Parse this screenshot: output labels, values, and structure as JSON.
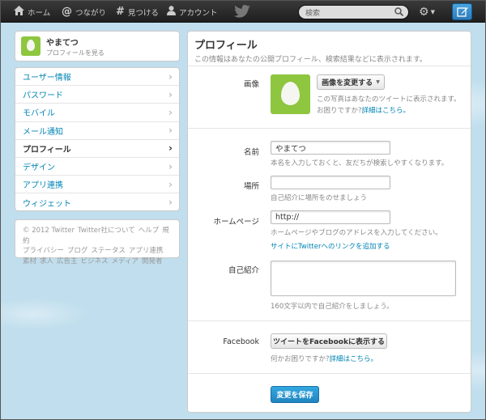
{
  "topbar": {
    "home_label": "ホーム",
    "connect_label": "つながり",
    "discover_label": "見つける",
    "account_label": "アカウント",
    "search_placeholder": "検索"
  },
  "profile_card": {
    "name": "やまてつ",
    "sub": "プロフィールを見る"
  },
  "sidenav": {
    "items": [
      {
        "label": "ユーザー情報"
      },
      {
        "label": "パスワード"
      },
      {
        "label": "モバイル"
      },
      {
        "label": "メール通知"
      },
      {
        "label": "プロフィール"
      },
      {
        "label": "デザイン"
      },
      {
        "label": "アプリ連携"
      },
      {
        "label": "ウィジェット"
      }
    ]
  },
  "footer": {
    "line1": [
      "© 2012 Twitter",
      "Twitter社について",
      "ヘルプ",
      "規約"
    ],
    "line2": [
      "プライバシー",
      "ブログ",
      "ステータス",
      "アプリ連携"
    ],
    "line3": [
      "素材",
      "求人",
      "広告主",
      "ビジネス",
      "メディア",
      "開発者"
    ]
  },
  "main": {
    "title": "プロフィール",
    "subtitle": "この情報はあなたの公開プロフィール、検索結果などに表示されます。",
    "image": {
      "label": "画像",
      "button": "画像を変更する",
      "hint": "この写真はあなたのツイートに表示されます。",
      "help_prefix": "お困りですか?",
      "help_link": "詳細はこちら。"
    },
    "name": {
      "label": "名前",
      "value": "やまてつ",
      "hint": "本名を入力しておくと、友だちが検索しやすくなります。"
    },
    "location": {
      "label": "場所",
      "value": "",
      "hint": "自己紹介に場所をのせましょう"
    },
    "homepage": {
      "label": "ホームページ",
      "value": "http://",
      "hint": "ホームページやブログのアドレスを入力してください。",
      "link": "サイトにTwitterへのリンクを追加する"
    },
    "bio": {
      "label": "自己紹介",
      "value": "",
      "hint": "160文字以内で自己紹介をしましょう。"
    },
    "facebook": {
      "label": "Facebook",
      "button": "ツイートをFacebookに表示する",
      "help_prefix": "何かお困りですか?",
      "help_link": "詳細はこちら。"
    },
    "save_label": "変更を保存"
  },
  "colors": {
    "accent": "#0084b4",
    "topbar": "#2b2b2b",
    "background": "#c0deed",
    "save_button": "#2a90d0"
  }
}
